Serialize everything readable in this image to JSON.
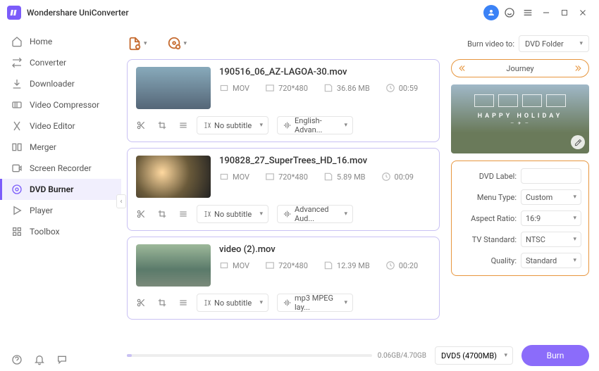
{
  "app": {
    "title": "Wondershare UniConverter"
  },
  "sidebar": {
    "items": [
      {
        "label": "Home",
        "icon": "home"
      },
      {
        "label": "Converter",
        "icon": "converter"
      },
      {
        "label": "Downloader",
        "icon": "downloader"
      },
      {
        "label": "Video Compressor",
        "icon": "compress"
      },
      {
        "label": "Video Editor",
        "icon": "editor"
      },
      {
        "label": "Merger",
        "icon": "merger"
      },
      {
        "label": "Screen Recorder",
        "icon": "recorder"
      },
      {
        "label": "DVD Burner",
        "icon": "dvd"
      },
      {
        "label": "Player",
        "icon": "player"
      },
      {
        "label": "Toolbox",
        "icon": "toolbox"
      }
    ]
  },
  "topbar": {
    "burn_to_label": "Burn video to:",
    "burn_to_value": "DVD Folder"
  },
  "files": [
    {
      "name": "190516_06_AZ-LAGOA-30.mov",
      "format": "MOV",
      "resolution": "720*480",
      "size": "36.86 MB",
      "duration": "00:59",
      "subtitle": "No subtitle",
      "audio": "English-Advan..."
    },
    {
      "name": "190828_27_SuperTrees_HD_16.mov",
      "format": "MOV",
      "resolution": "720*480",
      "size": "5.89 MB",
      "duration": "00:09",
      "subtitle": "No subtitle",
      "audio": "Advanced Aud..."
    },
    {
      "name": "video (2).mov",
      "format": "MOV",
      "resolution": "720*480",
      "size": "12.39 MB",
      "duration": "00:20",
      "subtitle": "No subtitle",
      "audio": "mp3 MPEG lay..."
    }
  ],
  "theme": {
    "name": "Journey",
    "preview_title": "HAPPY HOLIDAY"
  },
  "settings": {
    "labels": {
      "dvd_label": "DVD Label:",
      "menu_type": "Menu Type:",
      "aspect_ratio": "Aspect Ratio:",
      "tv_standard": "TV Standard:",
      "quality": "Quality:"
    },
    "dvd_label": "",
    "menu_type": "Custom",
    "aspect_ratio": "16:9",
    "tv_standard": "NTSC",
    "quality": "Standard"
  },
  "footer": {
    "progress_text": "0.06GB/4.70GB",
    "disc": "DVD5 (4700MB)",
    "burn_label": "Burn"
  }
}
